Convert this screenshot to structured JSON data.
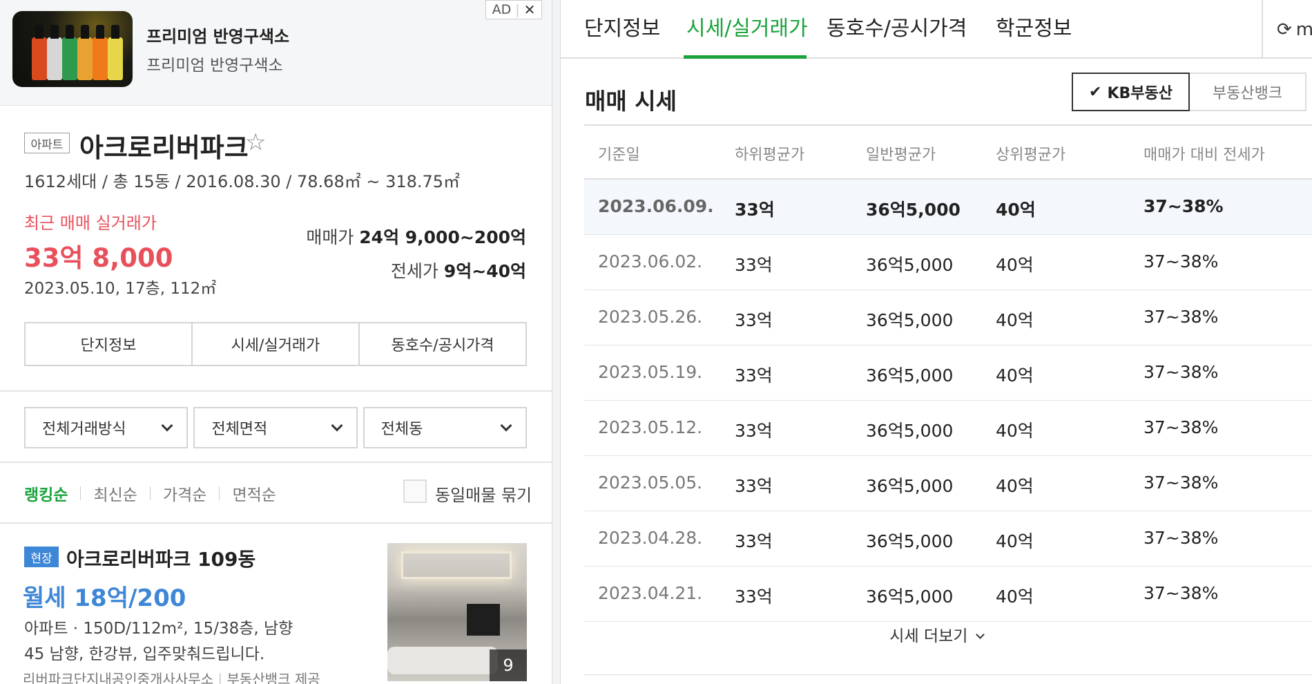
{
  "ad": {
    "tag": "AD",
    "close": "✕",
    "title": "프리미엄 반영구색소",
    "subtitle": "프리미엄 반영구색소",
    "bottle_colors": [
      "#d94a1e",
      "#d6d6d6",
      "#2f9a4e",
      "#e8a232",
      "#f07a1a",
      "#e7d64a"
    ]
  },
  "complex": {
    "type": "아파트",
    "name": "아크로리버파크",
    "meta": "1612세대 / 총 15동 / 2016.08.30 / 78.68㎡ ~ 318.75㎡",
    "recent_label": "최근 매매 실거래가",
    "recent_price": "33억 8,000",
    "recent_detail": "2023.05.10, 17층, 112㎡",
    "sale_label": "매매가",
    "sale_value": "24억 9,000~200억",
    "lease_label": "전세가",
    "lease_value": "9억~40억",
    "seg_buttons": [
      "단지정보",
      "시세/실거래가",
      "동호수/공시가격"
    ]
  },
  "filters": [
    "전체거래방식",
    "전체면적",
    "전체동"
  ],
  "sorts": {
    "items": [
      "랭킹순",
      "최신순",
      "가격순",
      "면적순"
    ],
    "active": 0,
    "group_label": "동일매물 묶기"
  },
  "listing": {
    "badge": "현장",
    "title": "아크로리버파크 109동",
    "price": "월세 18억/200",
    "spec_type": "아파트",
    "spec": "150D/112m², 15/38층, 남향",
    "desc": "45 남향, 한강뷰, 입주맞춰드립니다.",
    "agent": "리버파크단지내공인중개사사무소",
    "provider": "부동산뱅크 제공",
    "photo_count": "9"
  },
  "tabs": {
    "items": [
      "단지정보",
      "시세/실거래가",
      "동호수/공시가격",
      "학군정보"
    ],
    "active": 1,
    "refresh_text": "m"
  },
  "market": {
    "title": "매매 시세",
    "sources": [
      "KB부동산",
      "부동산뱅크"
    ],
    "selected_source": 0,
    "headers": [
      "기준일",
      "하위평균가",
      "일반평균가",
      "상위평균가",
      "매매가 대비 전세가"
    ],
    "rows": [
      [
        "2023.06.09.",
        "33억",
        "36억5,000",
        "40억",
        "37~38%"
      ],
      [
        "2023.06.02.",
        "33억",
        "36억5,000",
        "40억",
        "37~38%"
      ],
      [
        "2023.05.26.",
        "33억",
        "36억5,000",
        "40억",
        "37~38%"
      ],
      [
        "2023.05.19.",
        "33억",
        "36억5,000",
        "40억",
        "37~38%"
      ],
      [
        "2023.05.12.",
        "33억",
        "36억5,000",
        "40억",
        "37~38%"
      ],
      [
        "2023.05.05.",
        "33억",
        "36억5,000",
        "40억",
        "37~38%"
      ],
      [
        "2023.04.28.",
        "33억",
        "36억5,000",
        "40억",
        "37~38%"
      ],
      [
        "2023.04.21.",
        "33억",
        "36억5,000",
        "40억",
        "37~38%"
      ]
    ],
    "more_label": "시세 더보기"
  },
  "colors": {
    "brand_green": "#1aa33c",
    "price_red": "#e8505b",
    "listing_blue": "#3e86d6"
  }
}
